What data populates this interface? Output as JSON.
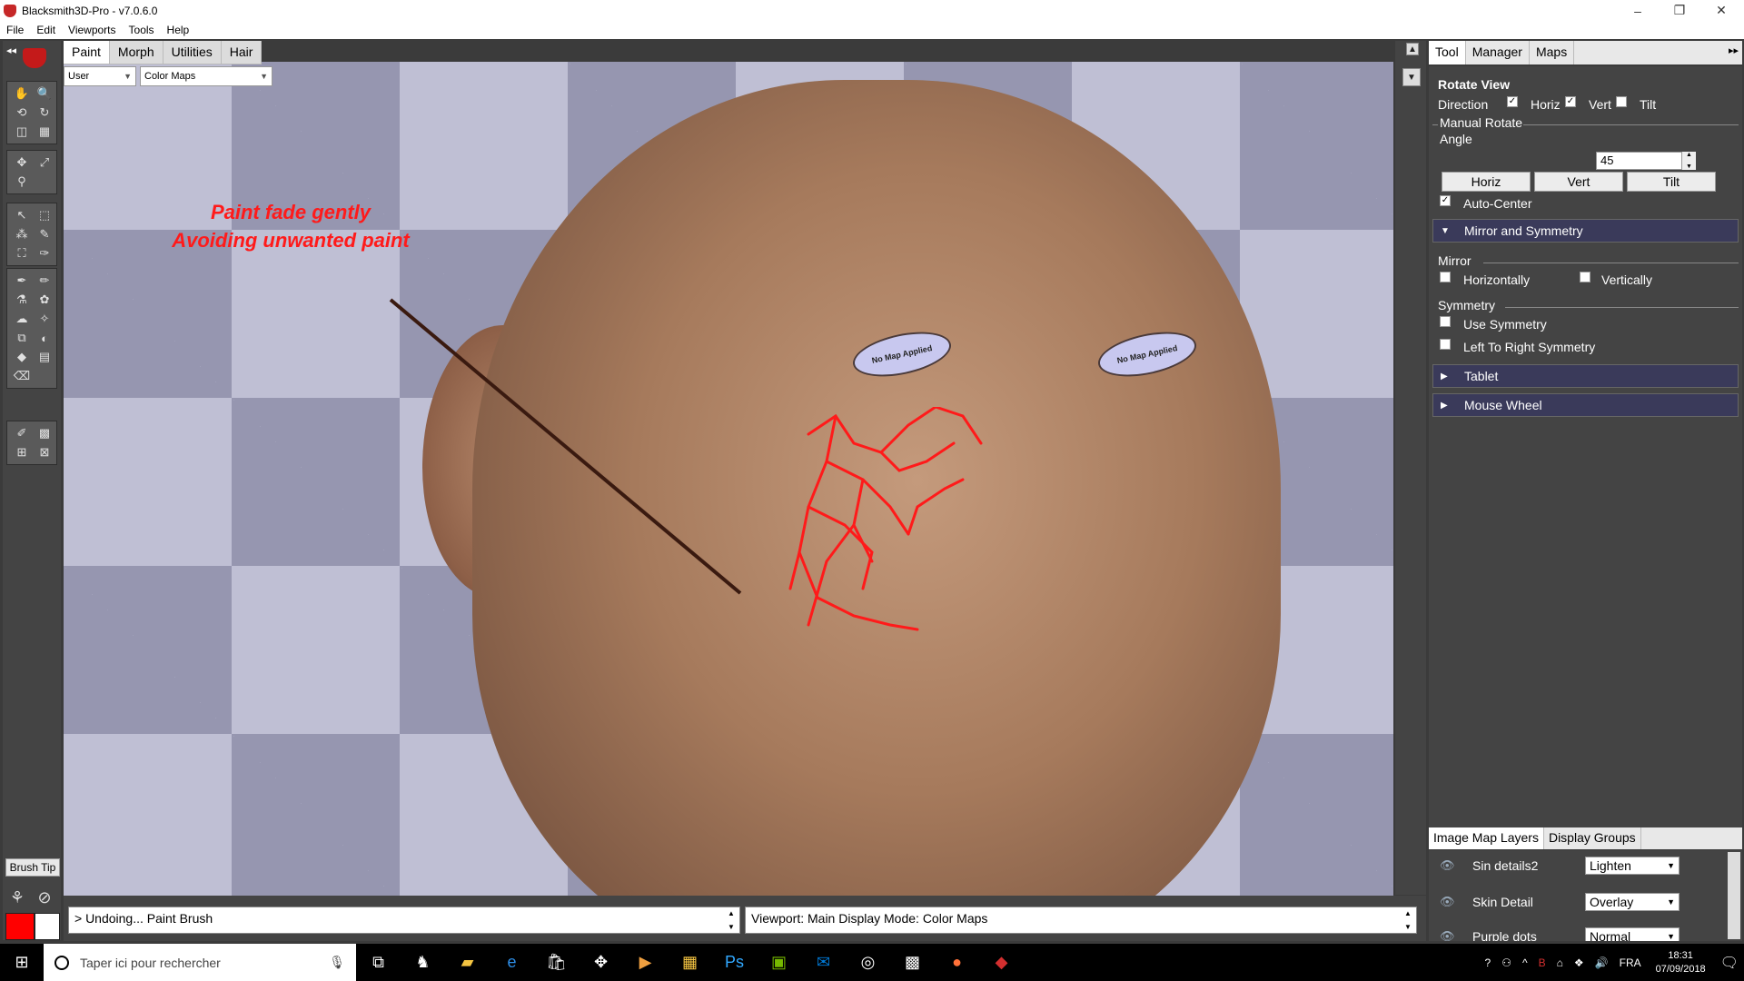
{
  "window": {
    "title": "Blacksmith3D-Pro - v7.0.6.0",
    "controls": {
      "minimize": "–",
      "restore": "❐",
      "close": "✕"
    }
  },
  "menu": [
    "File",
    "Edit",
    "Viewports",
    "Tools",
    "Help"
  ],
  "left_toolbar": {
    "toggle": "◂◂",
    "brush_tip_label": "Brush Tip",
    "primary_color": "#ff0000",
    "secondary_color": "#ffffff"
  },
  "viewport": {
    "tabs": [
      "Paint",
      "Morph",
      "Utilities",
      "Hair"
    ],
    "active_tab": "Paint",
    "mode_select": "User",
    "map_select": "Color Maps",
    "annotation": [
      "Paint fade gently",
      "Avoiding unwanted paint"
    ],
    "eye_text_left": "No Map Applied",
    "eye_text_right": "No Map Applied",
    "eye_text_small": "No",
    "checker_light": "#bfbfd4",
    "checker_dark": "#9696b0",
    "paint_color": "#ff1a1a"
  },
  "status": {
    "left": "> Undoing... Paint Brush",
    "right": "Viewport: Main Display Mode: Color Maps"
  },
  "right_panel": {
    "tabs": [
      "Tool",
      "Manager",
      "Maps"
    ],
    "active_tab": "Tool",
    "section_title": "Rotate View",
    "direction_label": "Direction",
    "direction_options": [
      {
        "label": "Horiz",
        "checked": true
      },
      {
        "label": "Vert",
        "checked": true
      },
      {
        "label": "Tilt",
        "checked": false
      }
    ],
    "manual_rotate_label": "Manual Rotate",
    "angle_label": "Angle",
    "angle_value": "45",
    "buttons": [
      "Horiz",
      "Vert",
      "Tilt"
    ],
    "auto_center": {
      "label": "Auto-Center",
      "checked": true
    },
    "mirror_section": "Mirror and Symmetry",
    "mirror_label": "Mirror",
    "mirror_options": [
      {
        "label": "Horizontally",
        "checked": false
      },
      {
        "label": "Vertically",
        "checked": false
      }
    ],
    "symmetry_label": "Symmetry",
    "symmetry_options": [
      {
        "label": "Use Symmetry",
        "checked": false
      },
      {
        "label": "Left To Right Symmetry",
        "checked": false
      }
    ],
    "tablet_section": "Tablet",
    "mouse_wheel_section": "Mouse Wheel",
    "layers_tabs": [
      "Image Map Layers",
      "Display Groups"
    ],
    "layers": [
      {
        "name": "Sin details2",
        "blend": "Lighten"
      },
      {
        "name": "Skin Detail",
        "blend": "Overlay"
      },
      {
        "name": "Purple dots",
        "blend": "Normal"
      }
    ]
  },
  "taskbar": {
    "search_placeholder": "Taper ici pour rechercher",
    "language": "FRA",
    "time": "18:31",
    "date": "07/09/2018"
  }
}
